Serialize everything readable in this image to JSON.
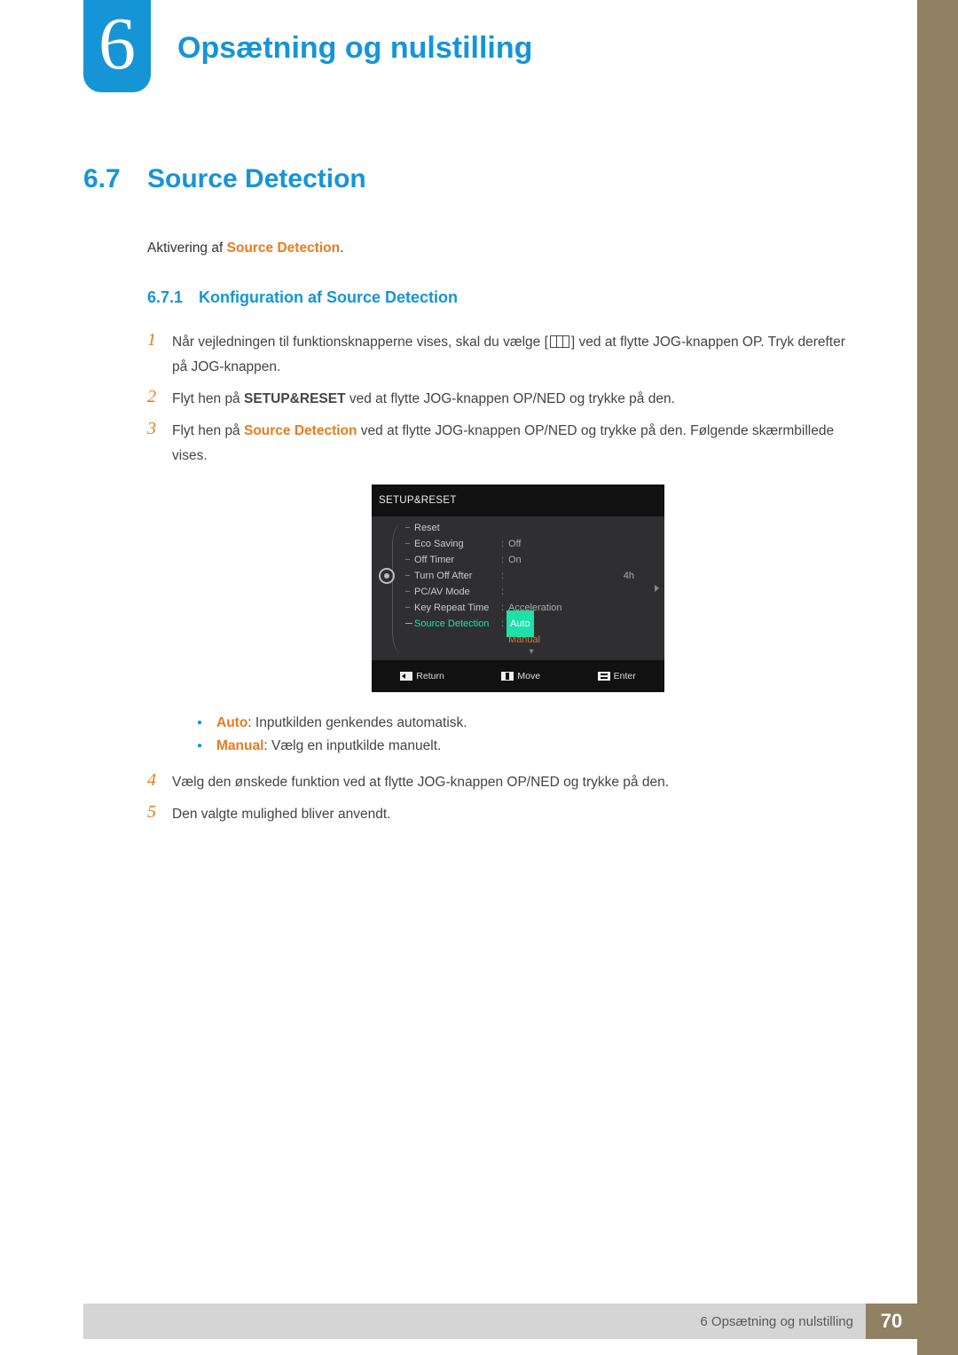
{
  "chapter": {
    "number": "6",
    "title": "Opsætning og nulstilling"
  },
  "section": {
    "number": "6.7",
    "title": "Source Detection"
  },
  "intro": {
    "prefix": "Aktivering af ",
    "term": "Source Detection",
    "suffix": "."
  },
  "subsection": {
    "number": "6.7.1",
    "title": "Konfiguration af Source Detection"
  },
  "steps": {
    "s1n": "1",
    "s1a": "Når vejledningen til funktionsknapperne vises, skal du vælge [",
    "s1b": "] ved at flytte JOG-knappen OP. Tryk derefter på JOG-knappen.",
    "s2n": "2",
    "s2a": "Flyt hen på ",
    "s2term": "SETUP&RESET",
    "s2b": " ved at flytte JOG-knappen OP/NED og trykke på den.",
    "s3n": "3",
    "s3a": "Flyt hen på ",
    "s3term": "Source Detection",
    "s3b": " ved at flytte JOG-knappen OP/NED og trykke på den. Følgende skærmbillede vises.",
    "s4n": "4",
    "s4": "Vælg den ønskede funktion ved at flytte JOG-knappen OP/NED og trykke på den.",
    "s5n": "5",
    "s5": "Den valgte mulighed bliver anvendt."
  },
  "osd": {
    "title": "SETUP&RESET",
    "rows": {
      "reset": "Reset",
      "eco": "Eco Saving",
      "eco_v": "Off",
      "off": "Off Timer",
      "off_v": "On",
      "turn": "Turn Off After",
      "turn_v": "4h",
      "pcav": "PC/AV Mode",
      "key": "Key Repeat Time",
      "key_v": "Acceleration",
      "src": "Source Detection",
      "src_v": "Auto",
      "manual": "Manual"
    },
    "down": "▾",
    "footer": {
      "return": "Return",
      "move": "Move",
      "enter": "Enter"
    }
  },
  "bullets": {
    "auto_term": "Auto",
    "auto_txt": ": Inputkilden genkendes automatisk.",
    "manual_term": "Manual",
    "manual_txt": ": Vælg en inputkilde manuelt."
  },
  "footer": {
    "text": "6 Opsætning og nulstilling",
    "page": "70"
  }
}
